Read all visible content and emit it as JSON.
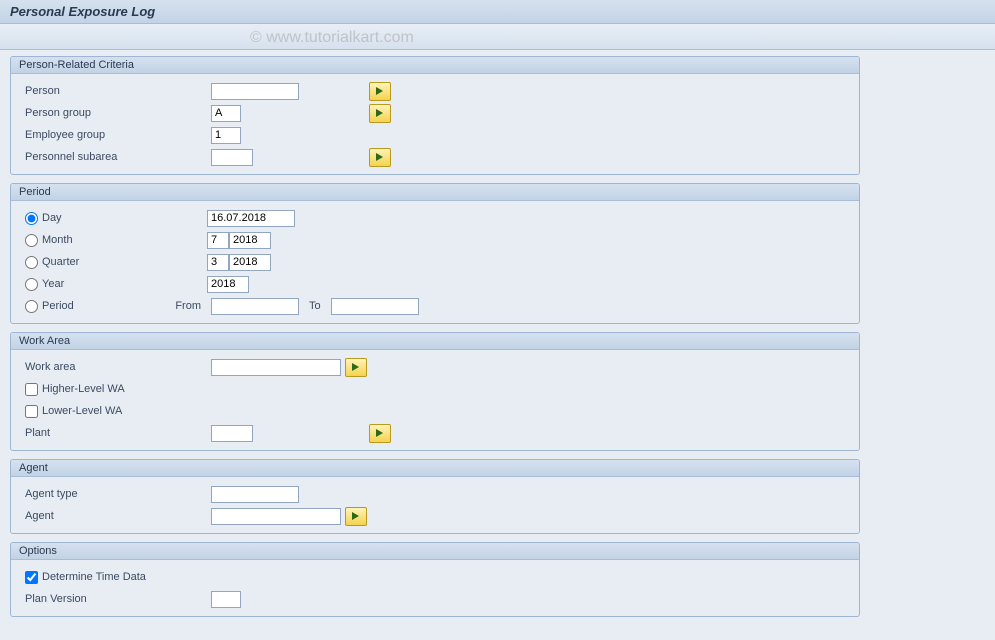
{
  "title": "Personal Exposure Log",
  "watermark": "© www.tutorialkart.com",
  "groups": {
    "person": {
      "title": "Person-Related Criteria",
      "person_label": "Person",
      "person_value": "",
      "group_label": "Person group",
      "group_value": "A",
      "emp_label": "Employee group",
      "emp_value": "1",
      "subarea_label": "Personnel subarea",
      "subarea_value": ""
    },
    "period": {
      "title": "Period",
      "day_label": "Day",
      "day_value": "16.07.2018",
      "month_label": "Month",
      "month_m": "7",
      "month_y": "2018",
      "quarter_label": "Quarter",
      "quarter_q": "3",
      "quarter_y": "2018",
      "year_label": "Year",
      "year_value": "2018",
      "period_label": "Period",
      "from_label": "From",
      "to_label": "To",
      "from_value": "",
      "to_value": ""
    },
    "workarea": {
      "title": "Work Area",
      "wa_label": "Work area",
      "wa_value": "",
      "higher_label": "Higher-Level WA",
      "lower_label": "Lower-Level WA",
      "plant_label": "Plant",
      "plant_value": ""
    },
    "agent": {
      "title": "Agent",
      "type_label": "Agent type",
      "type_value": "",
      "agent_label": "Agent",
      "agent_value": ""
    },
    "options": {
      "title": "Options",
      "det_label": "Determine Time Data",
      "plan_label": "Plan Version",
      "plan_value": ""
    }
  }
}
